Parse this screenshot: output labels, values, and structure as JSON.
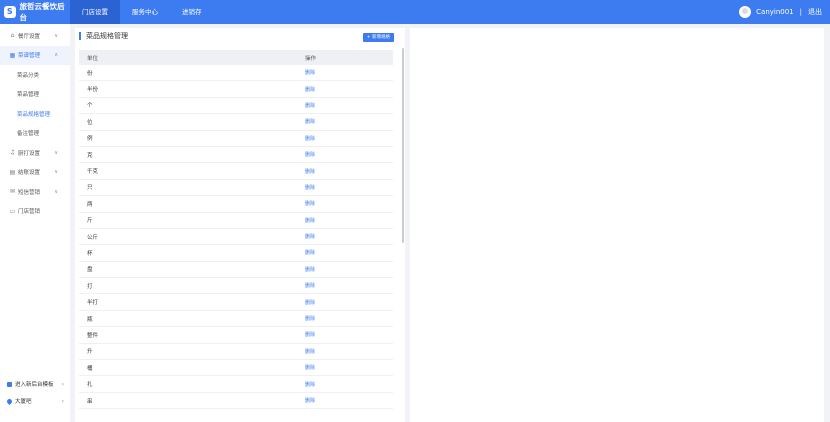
{
  "app": {
    "brand": "旅哲云餐饮后台",
    "brand_logo": "S"
  },
  "top_nav": {
    "items": [
      "门店设置",
      "服务中心",
      "进销存"
    ]
  },
  "user": {
    "name": "Canyin001",
    "separator": "|",
    "logout": "退出"
  },
  "sidebar": {
    "restaurant_settings": "餐厅设置",
    "dish_management": "菜谱管理",
    "sub_items": [
      "菜品分类",
      "菜品管理",
      "菜品规格管理",
      "备注管理"
    ],
    "store_settings": "厨打设置",
    "settlement_settings": "结账设置",
    "sms_marketing": "短信营销",
    "store_marketing": "门店营销",
    "enter_backend": "进入新后台模板",
    "location": "大厦吧"
  },
  "panel": {
    "title": "菜品规格管理",
    "add_button": "+ 新增规格",
    "columns": [
      "单位",
      "操作"
    ],
    "rows": [
      "份",
      "半份",
      "个",
      "位",
      "例",
      "克",
      "千克",
      "只",
      "两",
      "斤",
      "公斤",
      "杯",
      "盘",
      "打",
      "半打",
      "瓶",
      "整件",
      "升",
      "桶",
      "扎",
      "串"
    ],
    "delete_label": "删除"
  },
  "colors": {
    "primary": "#3d7bf0",
    "primary_dark": "#2c63d3",
    "background": "#f2f3f7"
  }
}
